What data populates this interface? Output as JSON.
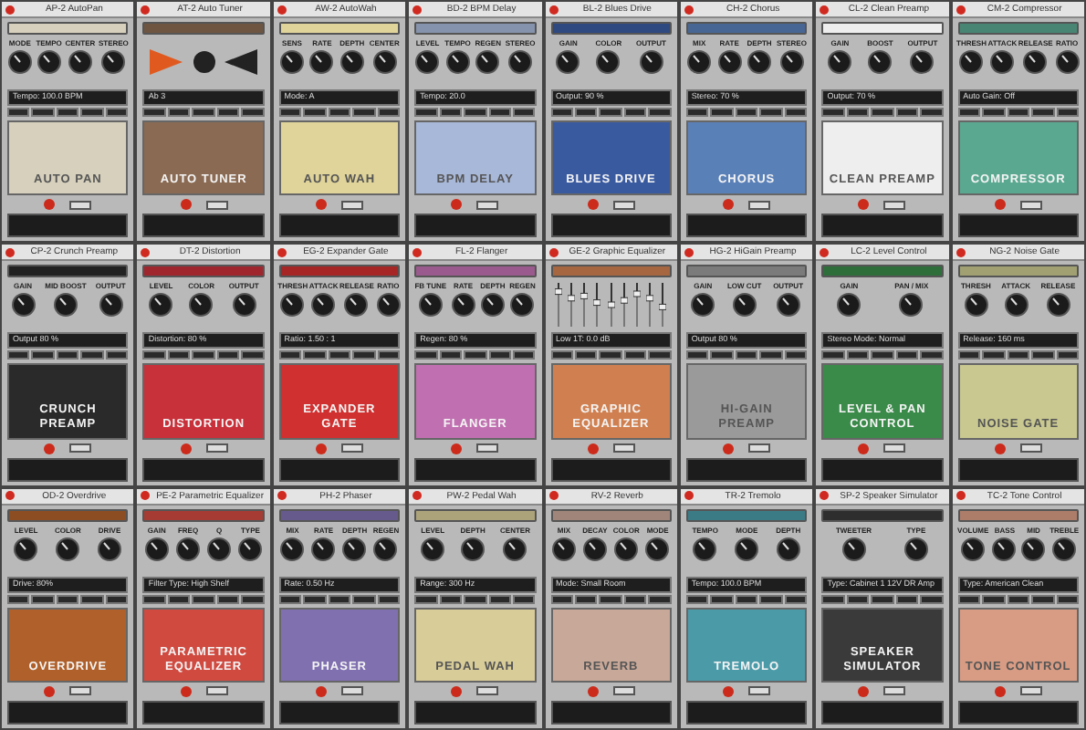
{
  "plugins": [
    {
      "title": "AP-2 AutoPan",
      "kind": "knobs",
      "knobs": [
        "MODE",
        "TEMPO",
        "CENTER",
        "STEREO"
      ],
      "display": "Tempo: 100.0 BPM",
      "name": "AUTO PAN",
      "color": "#d6d0bc"
    },
    {
      "title": "AT-2 Auto Tuner",
      "kind": "tuner",
      "display": "Ab 3",
      "name": "AUTO TUNER",
      "color": "#8a6a52"
    },
    {
      "title": "AW-2 AutoWah",
      "kind": "knobs",
      "knobs": [
        "SENS",
        "RATE",
        "DEPTH",
        "CENTER"
      ],
      "display": "Mode: A",
      "name": "AUTO WAH",
      "color": "#e0d49a"
    },
    {
      "title": "BD-2 BPM Delay",
      "kind": "knobs",
      "knobs": [
        "LEVEL",
        "TEMPO",
        "REGEN",
        "STEREO"
      ],
      "display": "Tempo: 20.0",
      "name": "BPM DELAY",
      "color": "#a8b8d8"
    },
    {
      "title": "BL-2 Blues Drive",
      "kind": "knobs",
      "knobs": [
        "GAIN",
        "COLOR",
        "OUTPUT"
      ],
      "display": "Output: 90 %",
      "name": "BLUES DRIVE",
      "color": "#3a5aa0"
    },
    {
      "title": "CH-2 Chorus",
      "kind": "knobs",
      "knobs": [
        "MIX",
        "RATE",
        "DEPTH",
        "STEREO"
      ],
      "display": "Stereo: 70 %",
      "name": "CHORUS",
      "color": "#5a80b8"
    },
    {
      "title": "CL-2 Clean Preamp",
      "kind": "knobs",
      "knobs": [
        "GAIN",
        "BOOST",
        "OUTPUT"
      ],
      "display": "Output: 70 %",
      "name": "CLEAN PREAMP",
      "color": "#eeeeee"
    },
    {
      "title": "CM-2 Compressor",
      "kind": "knobs",
      "knobs": [
        "THRESH",
        "ATTACK",
        "RELEASE",
        "RATIO"
      ],
      "display": "Auto Gain: Off",
      "name": "COMPRESSOR",
      "color": "#5aa890"
    },
    {
      "title": "CP-2 Crunch Preamp",
      "kind": "knobs",
      "knobs": [
        "GAIN",
        "MID BOOST",
        "OUTPUT"
      ],
      "display": "Output 80 %",
      "name": "CRUNCH PREAMP",
      "color": "#2a2a2a"
    },
    {
      "title": "DT-2 Distortion",
      "kind": "knobs",
      "knobs": [
        "LEVEL",
        "COLOR",
        "OUTPUT"
      ],
      "display": "Distortion: 80 %",
      "name": "DISTORTION",
      "color": "#c8303a"
    },
    {
      "title": "EG-2 Expander Gate",
      "kind": "knobs",
      "knobs": [
        "THRESH",
        "ATTACK",
        "RELEASE",
        "RATIO"
      ],
      "display": "Ratio: 1.50 : 1",
      "name": "EXPANDER GATE",
      "color": "#d03030"
    },
    {
      "title": "FL-2 Flanger",
      "kind": "knobs",
      "knobs": [
        "FB TUNE",
        "RATE",
        "DEPTH",
        "REGEN"
      ],
      "display": "Regen: 80 %",
      "name": "FLANGER",
      "color": "#c070b0"
    },
    {
      "title": "GE-2 Graphic Equalizer",
      "kind": "sliders",
      "sliders": [
        {
          "level": 0.8
        },
        {
          "level": 0.65
        },
        {
          "level": 0.7
        },
        {
          "level": 0.55
        },
        {
          "level": 0.5
        },
        {
          "level": 0.6
        },
        {
          "level": 0.75
        },
        {
          "level": 0.65
        },
        {
          "level": 0.45
        }
      ],
      "display": "Low 1T: 0.0 dB",
      "name": "GRAPHIC EQUALIZER",
      "color": "#d08050"
    },
    {
      "title": "HG-2 HiGain Preamp",
      "kind": "knobs",
      "knobs": [
        "GAIN",
        "LOW CUT",
        "OUTPUT"
      ],
      "display": "Output 80 %",
      "name": "HI-GAIN PREAMP",
      "color": "#9a9a9a"
    },
    {
      "title": "LC-2 Level Control",
      "kind": "knobs",
      "knobs": [
        "GAIN",
        "PAN / MIX"
      ],
      "display": "Stereo Mode: Normal",
      "name": "LEVEL & PAN CONTROL",
      "color": "#3a8a4a"
    },
    {
      "title": "NG-2 Noise Gate",
      "kind": "knobs",
      "knobs": [
        "THRESH",
        "ATTACK",
        "RELEASE"
      ],
      "display": "Release: 160 ms",
      "name": "NOISE GATE",
      "color": "#c8c890"
    },
    {
      "title": "OD-2 Overdrive",
      "kind": "knobs",
      "knobs": [
        "LEVEL",
        "COLOR",
        "DRIVE"
      ],
      "display": "Drive: 80%",
      "name": "OVERDRIVE",
      "color": "#b0602a"
    },
    {
      "title": "PE-2 Parametric Equalizer",
      "kind": "knobs",
      "knobs": [
        "GAIN",
        "FREQ",
        "Q",
        "TYPE"
      ],
      "display": "Filter Type: High Shelf",
      "name": "PARAMETRIC EQUALIZER",
      "color": "#d04a40"
    },
    {
      "title": "PH-2 Phaser",
      "kind": "knobs",
      "knobs": [
        "MIX",
        "RATE",
        "DEPTH",
        "REGEN"
      ],
      "display": "Rate: 0.50 Hz",
      "name": "PHASER",
      "color": "#8070b0"
    },
    {
      "title": "PW-2 Pedal Wah",
      "kind": "knobs",
      "knobs": [
        "LEVEL",
        "DEPTH",
        "CENTER"
      ],
      "display": "Range: 300 Hz",
      "name": "PEDAL WAH",
      "color": "#d8cc98"
    },
    {
      "title": "RV-2 Reverb",
      "kind": "knobs",
      "knobs": [
        "MIX",
        "DECAY",
        "COLOR",
        "MODE"
      ],
      "display": "Mode: Small Room",
      "name": "REVERB",
      "color": "#c8a898"
    },
    {
      "title": "TR-2 Tremolo",
      "kind": "knobs",
      "knobs": [
        "TEMPO",
        "MODE",
        "DEPTH"
      ],
      "display": "Tempo: 100.0 BPM",
      "name": "TREMOLO",
      "color": "#4a9aa8"
    },
    {
      "title": "SP-2 Speaker Simulator",
      "kind": "knobs",
      "knobs": [
        "TWEETER",
        "TYPE"
      ],
      "display": "Type: Cabinet 1 12V DR Amp",
      "name": "SPEAKER SIMULATOR",
      "color": "#3a3a3a"
    },
    {
      "title": "TC-2 Tone Control",
      "kind": "knobs",
      "knobs": [
        "VOLUME",
        "BASS",
        "MID",
        "TREBLE"
      ],
      "display": "Type: American Clean",
      "name": "TONE CONTROL",
      "color": "#d89c84"
    }
  ]
}
